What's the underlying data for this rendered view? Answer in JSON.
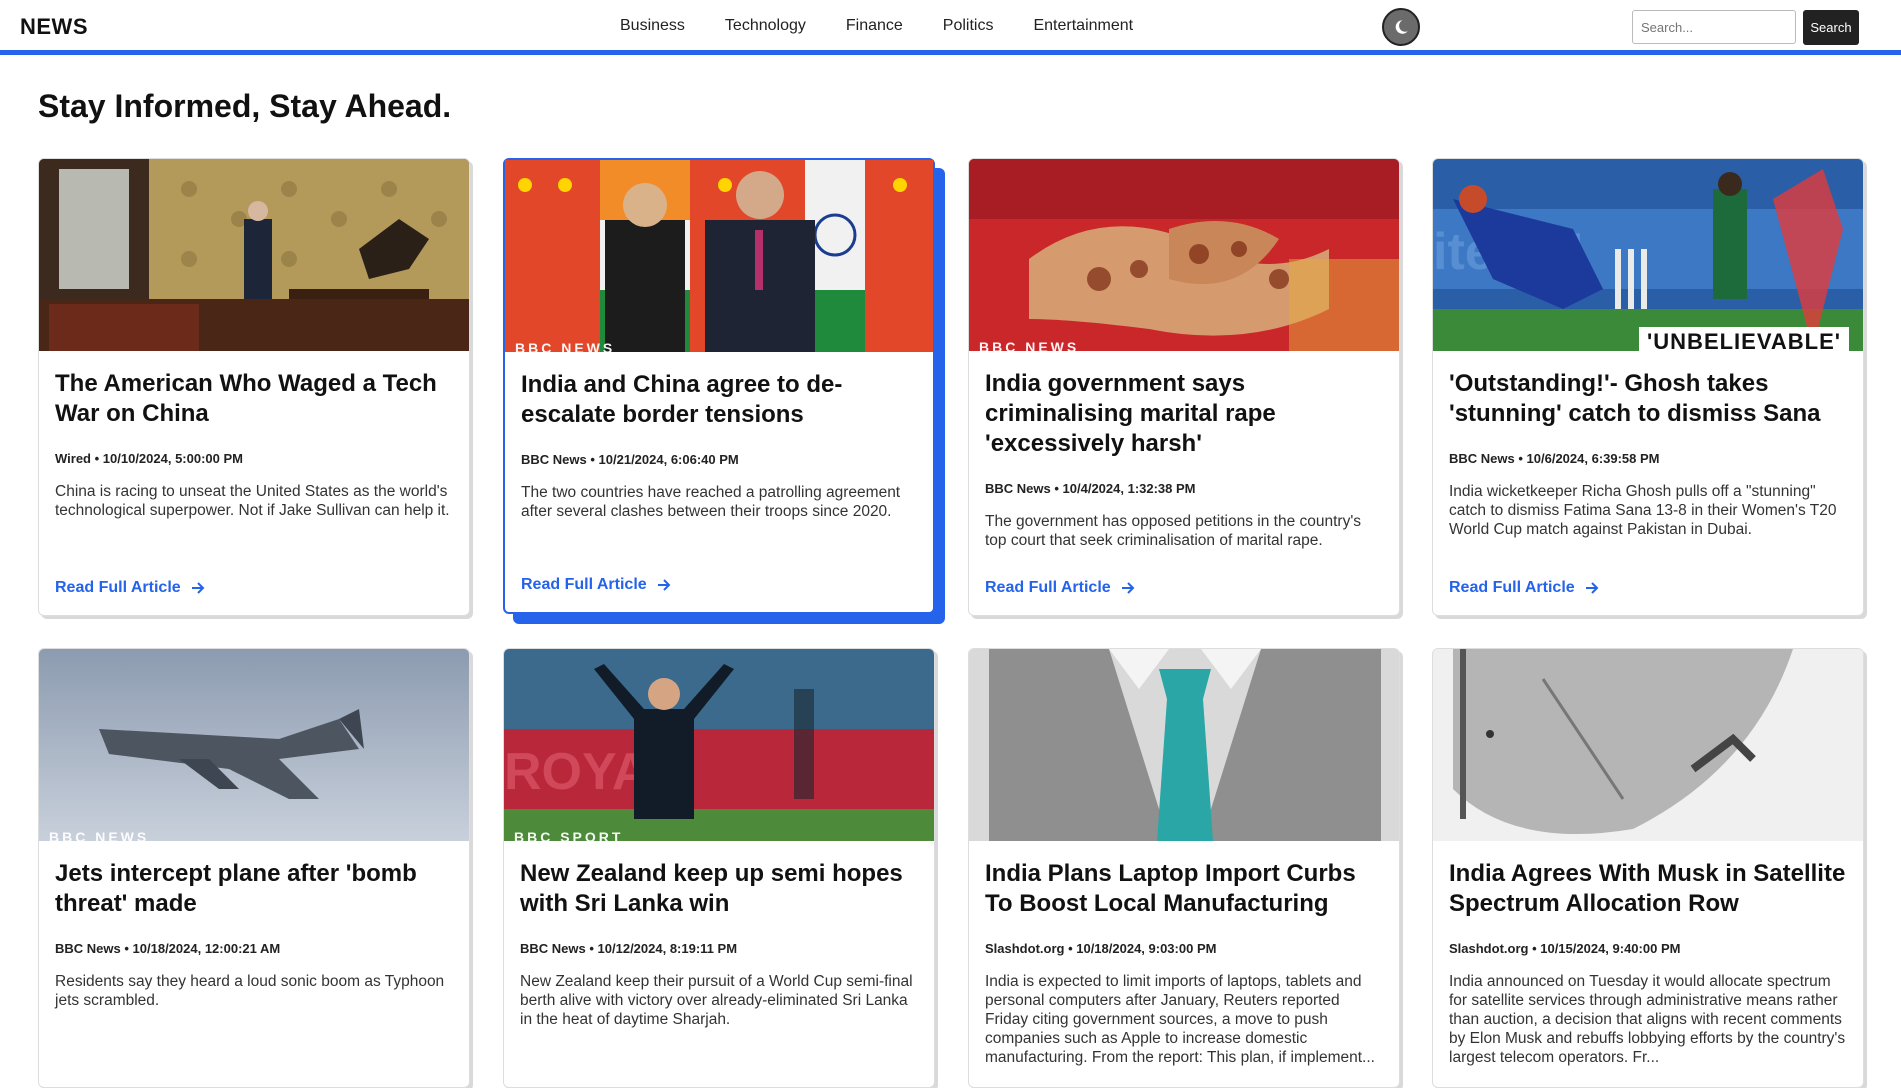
{
  "header": {
    "brand": "NEWS",
    "nav": [
      "Business",
      "Technology",
      "Finance",
      "Politics",
      "Entertainment"
    ],
    "search_placeholder": "Search...",
    "search_button": "Search",
    "theme_icon": "moon-icon"
  },
  "main": {
    "headline": "Stay Informed, Stay Ahead.",
    "read_more_label": "Read Full Article",
    "cards": [
      {
        "title": "The American Who Waged a Tech War on China",
        "source": "Wired",
        "date": "10/10/2024, 5:00:00 PM",
        "description": "China is racing to unseat the United States as the world's technological superpower. Not if Jake Sullivan can help it."
      },
      {
        "title": "India and China agree to de-escalate border tensions",
        "source": "BBC News",
        "date": "10/21/2024, 6:06:40 PM",
        "description": "The two countries have reached a patrolling agreement after several clashes between their troops since 2020.",
        "logo": "BBC NEWS"
      },
      {
        "title": "India government says criminalising marital rape 'excessively harsh'",
        "source": "BBC News",
        "date": "10/4/2024, 1:32:38 PM",
        "description": "The government has opposed petitions in the country's top court that seek criminalisation of marital rape.",
        "logo": "BBC NEWS"
      },
      {
        "title": "'Outstanding!'- Ghosh takes 'stunning' catch to dismiss Sana",
        "source": "BBC News",
        "date": "10/6/2024, 6:39:58 PM",
        "description": "India wicketkeeper Richa Ghosh pulls off a \"stunning\" catch to dismiss Fatima Sana 13-8 in their Women's T20 World Cup match against Pakistan in Dubai.",
        "overlay": "'UNBELIEVABLE'"
      },
      {
        "title": "Jets intercept plane after 'bomb threat' made",
        "source": "BBC News",
        "date": "10/18/2024, 12:00:21 AM",
        "description": "Residents say they heard a loud sonic boom as Typhoon jets scrambled.",
        "logo": "BBC NEWS"
      },
      {
        "title": "New Zealand keep up semi hopes with Sri Lanka win",
        "source": "BBC News",
        "date": "10/12/2024, 8:19:11 PM",
        "description": "New Zealand keep their pursuit of a World Cup semi-final berth alive with victory over already-eliminated Sri Lanka in the heat of daytime Sharjah.",
        "logo": "BBC SPORT"
      },
      {
        "title": "India Plans Laptop Import Curbs To Boost Local Manufacturing",
        "source": "Slashdot.org",
        "date": "10/18/2024, 9:03:00 PM",
        "description": "India is expected to limit imports of laptops, tablets and personal computers after January, Reuters reported Friday citing government sources, a move to push companies such as Apple to increase domestic manufacturing. From the report: This plan, if implement..."
      },
      {
        "title": "India Agrees With Musk in Satellite Spectrum Allocation Row",
        "source": "Slashdot.org",
        "date": "10/15/2024, 9:40:00 PM",
        "description": "India announced on Tuesday it would allocate spectrum for satellite services through administrative means rather than auction, a decision that aligns with recent comments by Elon Musk and rebuffs lobbying efforts by the country's largest telecom operators. Fr..."
      }
    ]
  }
}
